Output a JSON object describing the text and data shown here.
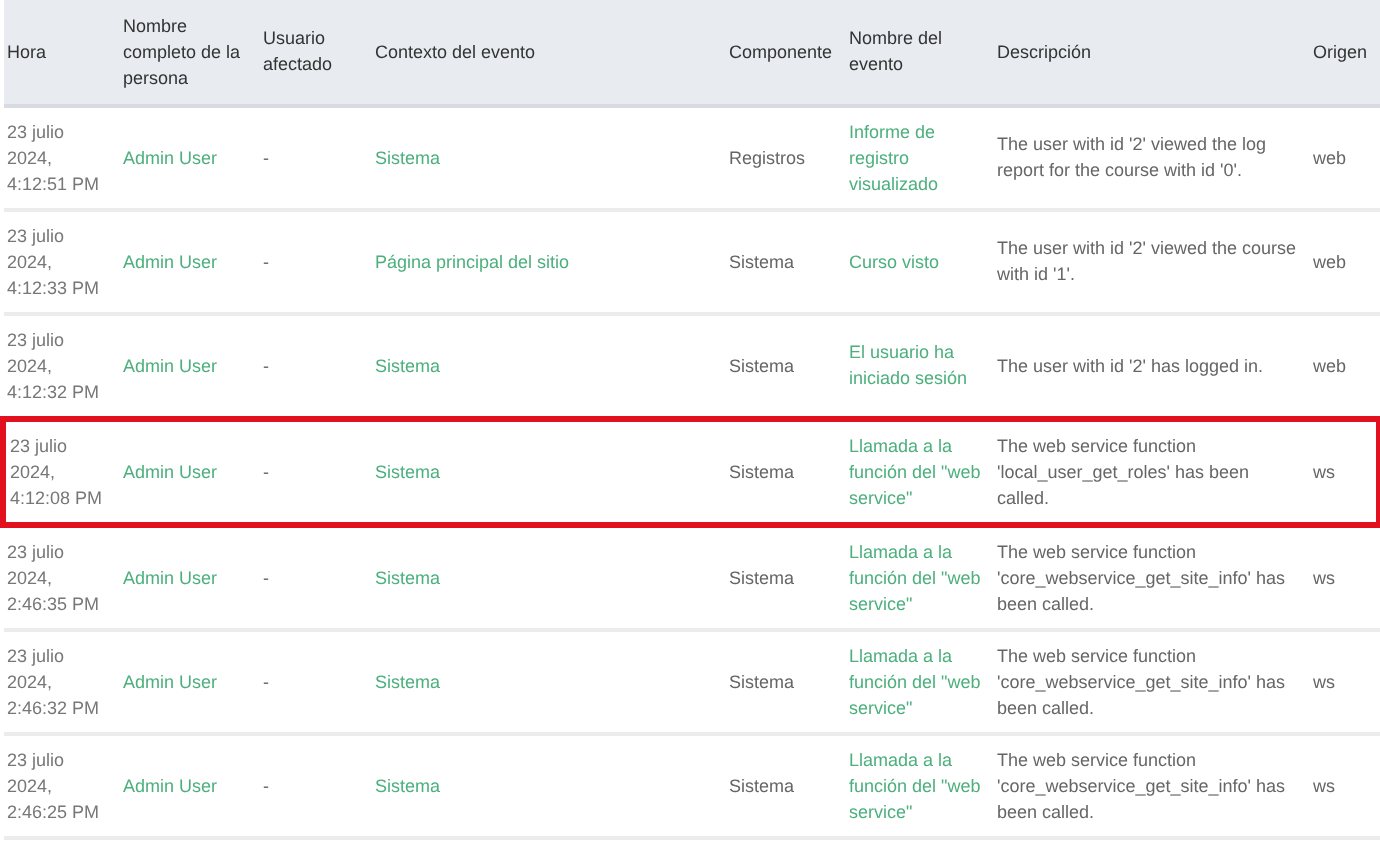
{
  "table": {
    "columns": [
      "Hora",
      "Nombre completo de la persona",
      "Usuario afectado",
      "Contexto del evento",
      "Componente",
      "Nombre del evento",
      "Descripción",
      "Origen"
    ],
    "rows": [
      {
        "time": "23 julio 2024, 4:12:51 PM",
        "user": "Admin User",
        "affected": "-",
        "context": "Sistema",
        "component": "Registros",
        "event": "Informe de registro visualizado",
        "description": "The user with id '2' viewed the log report for the course with id '0'.",
        "origin": "web",
        "highlighted": false
      },
      {
        "time": "23 julio 2024, 4:12:33 PM",
        "user": "Admin User",
        "affected": "-",
        "context": "Página principal del sitio",
        "component": "Sistema",
        "event": "Curso visto",
        "description": "The user with id '2' viewed the course with id '1'.",
        "origin": "web",
        "highlighted": false
      },
      {
        "time": "23 julio 2024, 4:12:32 PM",
        "user": "Admin User",
        "affected": "-",
        "context": "Sistema",
        "component": "Sistema",
        "event": "El usuario ha iniciado sesión",
        "description": "The user with id '2' has logged in.",
        "origin": "web",
        "highlighted": false
      },
      {
        "time": "23 julio 2024, 4:12:08 PM",
        "user": "Admin User",
        "affected": "-",
        "context": "Sistema",
        "component": "Sistema",
        "event": "Llamada a la función del \"web service\"",
        "description": "The web service function 'local_user_get_roles' has been called.",
        "origin": "ws",
        "highlighted": true
      },
      {
        "time": "23 julio 2024, 2:46:35 PM",
        "user": "Admin User",
        "affected": "-",
        "context": "Sistema",
        "component": "Sistema",
        "event": "Llamada a la función del \"web service\"",
        "description": "The web service function 'core_webservice_get_site_info' has been called.",
        "origin": "ws",
        "highlighted": false
      },
      {
        "time": "23 julio 2024, 2:46:32 PM",
        "user": "Admin User",
        "affected": "-",
        "context": "Sistema",
        "component": "Sistema",
        "event": "Llamada a la función del \"web service\"",
        "description": "The web service function 'core_webservice_get_site_info' has been called.",
        "origin": "ws",
        "highlighted": false
      },
      {
        "time": "23 julio 2024, 2:46:25 PM",
        "user": "Admin User",
        "affected": "-",
        "context": "Sistema",
        "component": "Sistema",
        "event": "Llamada a la función del \"web service\"",
        "description": "The web service function 'core_webservice_get_site_info' has been called.",
        "origin": "ws",
        "highlighted": false
      }
    ]
  }
}
